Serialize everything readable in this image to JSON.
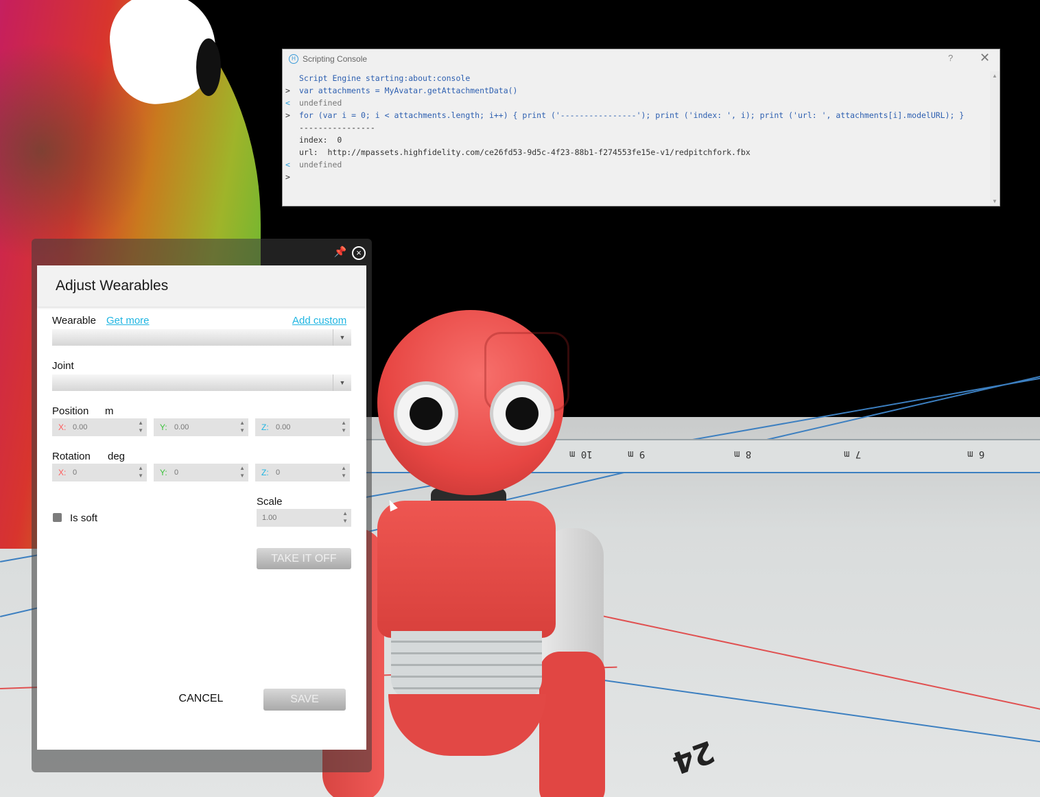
{
  "console": {
    "title": "Scripting Console",
    "help_label": "?",
    "close_label": "✕",
    "lines": [
      {
        "type": "info",
        "prompt": "",
        "text": "Script Engine starting:about:console"
      },
      {
        "type": "in",
        "prompt": ">",
        "text": "var attachments = MyAvatar.getAttachmentData()"
      },
      {
        "type": "res",
        "prompt": "<",
        "text": "undefined"
      },
      {
        "type": "in",
        "prompt": ">",
        "text": "for (var i = 0; i < attachments.length; i++) { print ('----------------'); print ('index: ', i); print ('url: ', attachments[i].modelURL); }"
      },
      {
        "type": "out",
        "prompt": "",
        "text": "----------------"
      },
      {
        "type": "out",
        "prompt": "",
        "text": "index:  0"
      },
      {
        "type": "out",
        "prompt": "",
        "text": "url:  http://mpassets.highfidelity.com/ce26fd53-9d5c-4f23-88b1-f274553fe15e-v1/redpitchfork.fbx"
      },
      {
        "type": "res",
        "prompt": "<",
        "text": "undefined"
      },
      {
        "type": "in",
        "prompt": ">",
        "text": ""
      }
    ]
  },
  "dialog": {
    "title": "Adjust Wearables",
    "wearable_label": "Wearable",
    "get_more_label": "Get more",
    "add_custom_label": "Add custom",
    "wearable_value": "",
    "joint_label": "Joint",
    "joint_value": "",
    "position_label": "Position",
    "position_unit": "m",
    "position": {
      "x": "0.00",
      "y": "0.00",
      "z": "0.00"
    },
    "rotation_label": "Rotation",
    "rotation_unit": "deg",
    "rotation": {
      "x": "0",
      "y": "0",
      "z": "0"
    },
    "axis_labels": {
      "x": "X:",
      "y": "Y:",
      "z": "Z:"
    },
    "scale_label": "Scale",
    "scale_value": "1.00",
    "is_soft_label": "Is soft",
    "is_soft_checked": false,
    "take_off_label": "TAKE IT OFF",
    "cancel_label": "CANCEL",
    "save_label": "SAVE"
  },
  "scene": {
    "floor_band_labels": [
      "10 m",
      "9 m",
      "8 m",
      "7 m",
      "6 m"
    ],
    "floor_number": "24"
  },
  "colors": {
    "accent": "#1fb5e2",
    "axis_x": "#ff5b5b",
    "axis_y": "#3dc23d",
    "axis_z": "#1fb5e2"
  }
}
